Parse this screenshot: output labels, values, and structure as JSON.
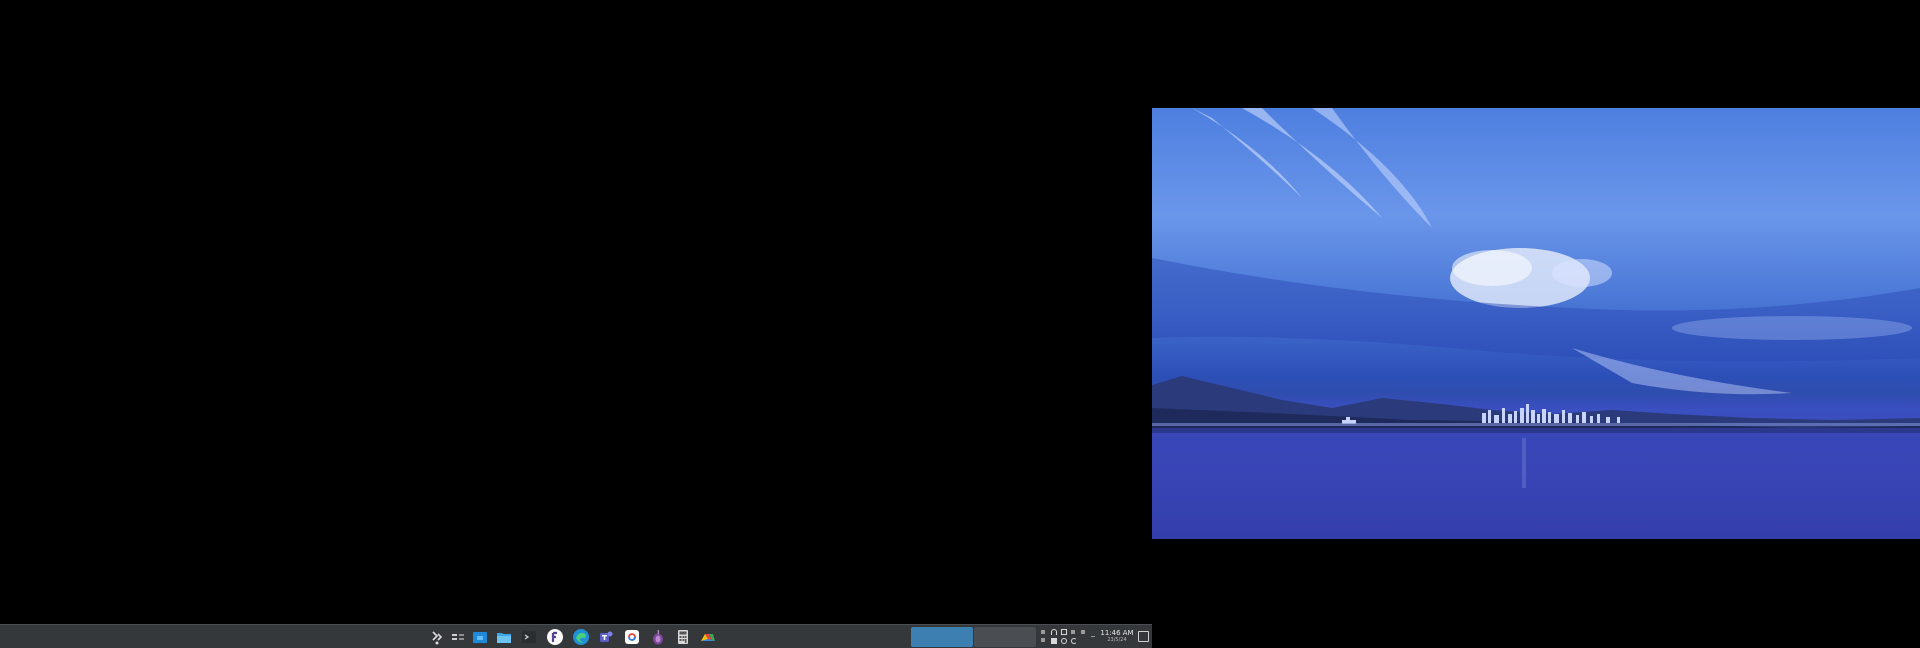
{
  "wallpaper": {
    "subject": "city-skyline-at-dusk"
  },
  "taskbar": {
    "launchers": [
      {
        "icon": "application-launcher-icon"
      },
      {
        "icon": "pager-icon"
      },
      {
        "icon": "file-manager-icon"
      },
      {
        "icon": "folder-icon"
      },
      {
        "icon": "terminal-icon"
      },
      {
        "icon": "fedora-icon"
      },
      {
        "icon": "edge-browser-icon"
      },
      {
        "icon": "teams-icon"
      },
      {
        "icon": "sync-app-icon"
      },
      {
        "icon": "tor-browser-icon"
      },
      {
        "icon": "calculator-icon"
      },
      {
        "icon": "cloud-app-icon"
      }
    ],
    "clock": {
      "time": "11:46 AM",
      "date": "23/5/24"
    }
  },
  "colors": {
    "taskbar_bg": "#35383b",
    "active_task": "#3d7fb0",
    "inactive_task": "#4a4d51",
    "desktop_bg": "#000000"
  }
}
